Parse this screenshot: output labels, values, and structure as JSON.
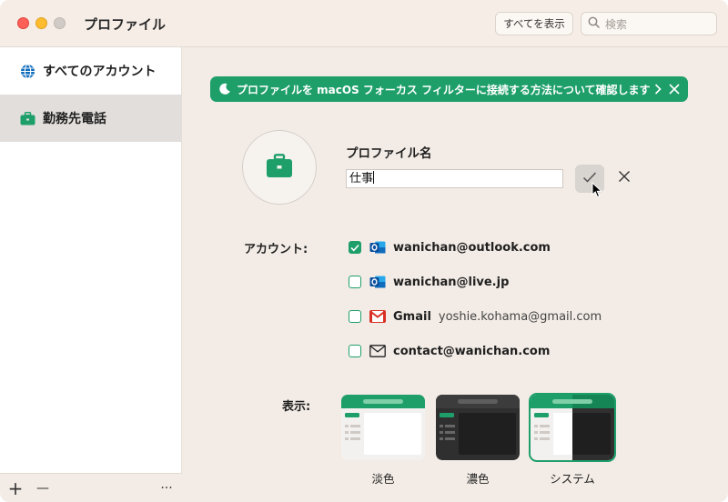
{
  "window": {
    "title": "プロファイル"
  },
  "toolbar": {
    "show_all_label": "すべてを表示",
    "search_placeholder": "検索"
  },
  "sidebar": {
    "items": [
      {
        "label": "すべてのアカウント",
        "icon": "globe-icon",
        "selected": false
      },
      {
        "label": "勤務先電話",
        "icon": "briefcase-icon",
        "selected": true
      }
    ],
    "footer": {
      "add": "+",
      "remove": "—",
      "more": "···"
    }
  },
  "banner": {
    "text": "プロファイルを macOS フォーカス フィルターに接続する方法について確認します"
  },
  "profile": {
    "name_label": "プロファイル名",
    "name_value": "仕事"
  },
  "accounts": {
    "label": "アカウント:",
    "items": [
      {
        "email": "wanichan@outlook.com",
        "sub": "",
        "checked": true,
        "icon": "outlook-icon"
      },
      {
        "email": "wanichan@live.jp",
        "sub": "",
        "checked": false,
        "icon": "outlook-icon"
      },
      {
        "email": "Gmail",
        "sub": "yoshie.kohama@gmail.com",
        "checked": false,
        "icon": "gmail-icon"
      },
      {
        "email": "contact@wanichan.com",
        "sub": "",
        "checked": false,
        "icon": "mail-icon"
      }
    ]
  },
  "display": {
    "label": "表示:",
    "themes": [
      {
        "label": "淡色",
        "selected": false
      },
      {
        "label": "濃色",
        "selected": false
      },
      {
        "label": "システム",
        "selected": true
      }
    ]
  },
  "colors": {
    "accent": "#1e9f6a",
    "outlook": "#0f6cbd",
    "gmail": "#d93025"
  }
}
